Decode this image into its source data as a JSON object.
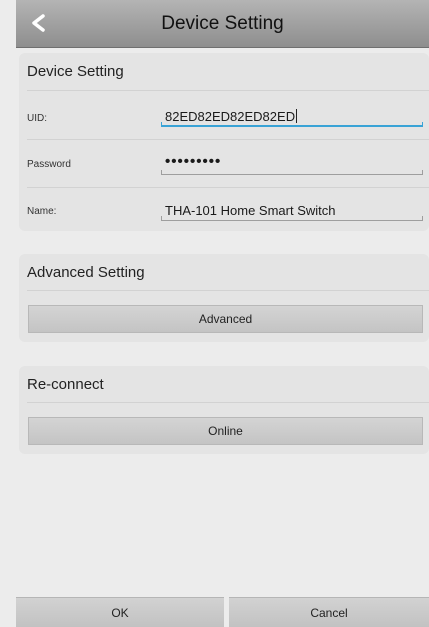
{
  "header": {
    "title": "Device Setting",
    "back_icon": "chevron-left-icon"
  },
  "device_panel": {
    "title": "Device Setting",
    "uid_label": "UID:",
    "uid_value": "82ED82ED82ED82ED",
    "password_label": "Password",
    "password_value": "•••••••••",
    "name_label": "Name:",
    "name_value": "THA-101 Home Smart Switch"
  },
  "advanced_panel": {
    "title": "Advanced Setting",
    "button_label": "Advanced"
  },
  "reconnect_panel": {
    "title": "Re-connect",
    "button_label": "Online"
  },
  "footer": {
    "ok_label": "OK",
    "cancel_label": "Cancel"
  },
  "colors": {
    "background": "#ececec",
    "panel": "#e4e4e4",
    "focus_accent": "#39a3d6",
    "header": "#9e9e9e"
  }
}
